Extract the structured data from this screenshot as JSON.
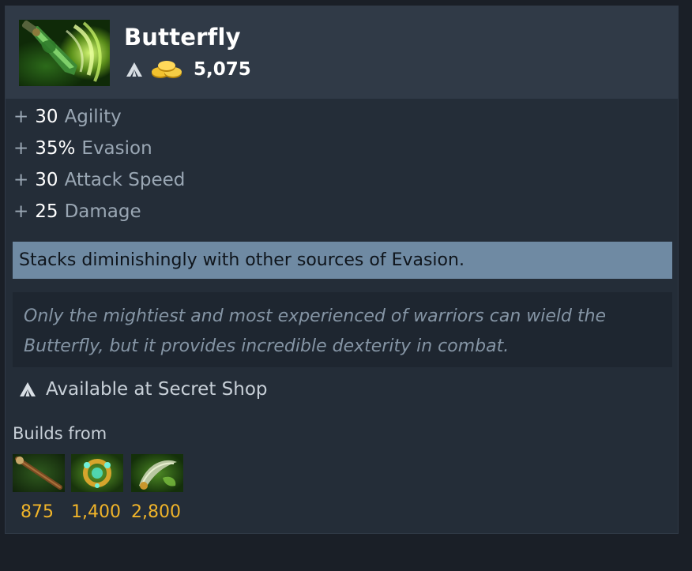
{
  "item": {
    "name": "Butterfly",
    "cost": "5,075",
    "icons": {
      "shop": "secret-shop-icon",
      "gold": "gold-coins-icon"
    }
  },
  "attributes": [
    {
      "plus": "+",
      "value": "30",
      "label": "Agility"
    },
    {
      "plus": "+",
      "value": "35%",
      "label": "Evasion"
    },
    {
      "plus": "+",
      "value": "30",
      "label": "Attack Speed"
    },
    {
      "plus": "+",
      "value": "25",
      "label": "Damage"
    }
  ],
  "note": "Stacks diminishingly with other sources of Evasion.",
  "lore": "Only the mightiest and most experienced of warriors can wield the Butterfly, but it provides incredible dexterity in combat.",
  "availability": "Available at Secret Shop",
  "builds": {
    "label": "Builds from",
    "components": [
      {
        "icon": "staff-icon",
        "cost": "875"
      },
      {
        "icon": "ring-icon",
        "cost": "1,400"
      },
      {
        "icon": "sword-icon",
        "cost": "2,800"
      }
    ]
  },
  "colors": {
    "gold": "#f0b429",
    "note_bg": "#6f8aa3",
    "card_bg": "#242d38",
    "header_bg": "#303a47"
  }
}
